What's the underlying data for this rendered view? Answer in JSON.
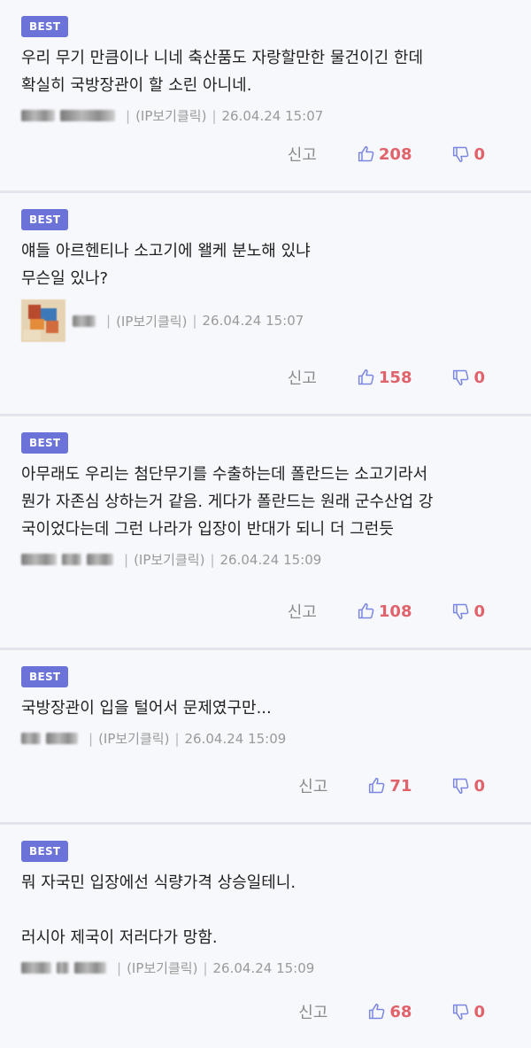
{
  "comments": [
    {
      "badge": "BEST",
      "text": "우리 무기 만큼이나 니네 축산품도 자랑할만한 물건이긴 한데\n확실히 국방장관이 할 소린 아니네.",
      "ip": "(IP보기클릭)",
      "date": "26.04.24 15:07",
      "report": "신고",
      "likes": "208",
      "dislikes": "0"
    },
    {
      "badge": "BEST",
      "text": "얘들 아르헨티나 소고기에 왤케 분노해 있냐\n무슨일 있나?",
      "ip": "(IP보기클릭)",
      "date": "26.04.24 15:07",
      "report": "신고",
      "likes": "158",
      "dislikes": "0"
    },
    {
      "badge": "BEST",
      "text": "아무래도 우리는 첨단무기를 수출하는데 폴란드는 소고기라서\n뭔가 자존심 상하는거 같음. 게다가 폴란드는 원래 군수산업 강\n국이었다는데 그런 나라가 입장이 반대가 되니 더 그런듯",
      "ip": "(IP보기클릭)",
      "date": "26.04.24 15:09",
      "report": "신고",
      "likes": "108",
      "dislikes": "0"
    },
    {
      "badge": "BEST",
      "text": "국방장관이 입을 털어서 문제였구만...",
      "ip": "(IP보기클릭)",
      "date": "26.04.24 15:09",
      "report": "신고",
      "likes": "71",
      "dislikes": "0"
    },
    {
      "badge": "BEST",
      "text": "뭐 자국민 입장에선 식량가격 상승일테니.\n\n러시아 제국이 저러다가 망함.",
      "ip": "(IP보기클릭)",
      "date": "26.04.24 15:09",
      "report": "신고",
      "likes": "68",
      "dislikes": "0"
    }
  ],
  "colors": {
    "badge": "#6b73d9",
    "count": "#e0626b",
    "thumb": "#7b86e0"
  },
  "icons": {
    "like": "thumbs-up-icon",
    "dislike": "thumbs-down-icon"
  }
}
